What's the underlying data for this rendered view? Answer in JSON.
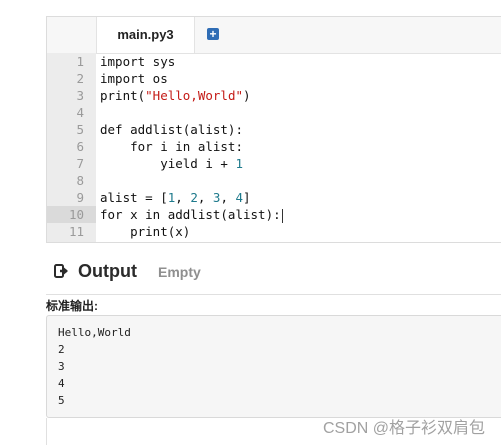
{
  "editor": {
    "tab_label": "main.py3",
    "add_tab_icon": "plus-square-icon",
    "lines": [
      {
        "n": "1",
        "tokens": [
          {
            "t": "import sys",
            "c": "plain"
          }
        ]
      },
      {
        "n": "2",
        "tokens": [
          {
            "t": "import os",
            "c": "plain"
          }
        ]
      },
      {
        "n": "3",
        "tokens": [
          {
            "t": "print(",
            "c": "plain"
          },
          {
            "t": "\"Hello,World\"",
            "c": "str"
          },
          {
            "t": ")",
            "c": "plain"
          }
        ]
      },
      {
        "n": "4",
        "tokens": []
      },
      {
        "n": "5",
        "tokens": [
          {
            "t": "def addlist(alist):",
            "c": "plain"
          }
        ]
      },
      {
        "n": "6",
        "tokens": [
          {
            "t": "    for i in alist:",
            "c": "plain"
          }
        ]
      },
      {
        "n": "7",
        "tokens": [
          {
            "t": "        yield i + ",
            "c": "plain"
          },
          {
            "t": "1",
            "c": "num"
          }
        ]
      },
      {
        "n": "8",
        "tokens": []
      },
      {
        "n": "9",
        "tokens": [
          {
            "t": "alist = [",
            "c": "plain"
          },
          {
            "t": "1",
            "c": "num"
          },
          {
            "t": ", ",
            "c": "plain"
          },
          {
            "t": "2",
            "c": "num"
          },
          {
            "t": ", ",
            "c": "plain"
          },
          {
            "t": "3",
            "c": "num"
          },
          {
            "t": ", ",
            "c": "plain"
          },
          {
            "t": "4",
            "c": "num"
          },
          {
            "t": "]",
            "c": "plain"
          }
        ]
      },
      {
        "n": "10",
        "tokens": [
          {
            "t": "for x in addlist(alist):",
            "c": "plain"
          }
        ],
        "active": true
      },
      {
        "n": "11",
        "tokens": [
          {
            "t": "    print(x)",
            "c": "plain"
          }
        ]
      }
    ]
  },
  "output": {
    "icon": "sign-out-icon",
    "title": "Output",
    "status": "Empty"
  },
  "stdout": {
    "label": "标准输出:",
    "lines": [
      "Hello,World",
      "2",
      "3",
      "4",
      "5"
    ]
  },
  "watermark": "CSDN @格子衫双肩包",
  "colors": {
    "string": "#c41a16",
    "number": "#1e7a8c",
    "gutter": "#ececec",
    "add_button": "#2f6db5"
  }
}
